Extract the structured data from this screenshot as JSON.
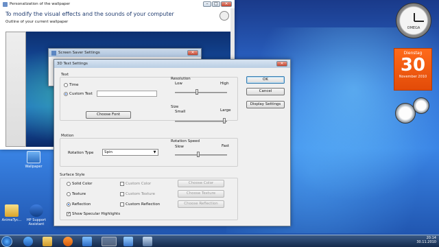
{
  "personalization": {
    "title": "Personalization of the wallpaper",
    "heading": "To modify the visual effects and the sounds of your computer",
    "subheading": "Outline of your current wallpaper"
  },
  "screensaver": {
    "title": "Screen Saver Settings"
  },
  "dialog3d": {
    "title": "3D Text Settings",
    "text_group": "Text",
    "time_label": "Time",
    "custom_text_label": "Custom Text",
    "custom_text_value": "",
    "choose_font": "Choose Font",
    "resolution_group": "Resolution",
    "resolution_low": "Low",
    "resolution_high": "High",
    "size_group": "Size",
    "size_small": "Small",
    "size_large": "Large",
    "motion_group": "Motion",
    "rotation_type_label": "Rotation Type",
    "rotation_type_value": "Spin",
    "rotation_speed_group": "Rotation Speed",
    "speed_slow": "Slow",
    "speed_fast": "Fast",
    "surface_group": "Surface Style",
    "solid_color": "Solid Color",
    "texture": "Texture",
    "reflection": "Reflection",
    "custom_color": "Custom Color",
    "custom_texture": "Custom Texture",
    "custom_reflection": "Custom Reflection",
    "choose_color": "Choose Color",
    "choose_texture": "Choose Texture",
    "choose_reflection": "Choose Reflection",
    "specular": "Show Specular Highlights",
    "ok": "OK",
    "cancel": "Cancel",
    "display_settings": "Display Settings"
  },
  "desktop": {
    "icons": [
      {
        "label": "Wallpaper"
      },
      {
        "label": "AnimeTyc..."
      },
      {
        "label": "HP Support Assistant"
      }
    ]
  },
  "gadgets": {
    "clock_brand": "OMEGA",
    "calendar_day": "Dienstag",
    "calendar_date": "30",
    "calendar_month": "November 2010"
  },
  "taskbar": {
    "time": "20:14",
    "date": "30.11.2010"
  },
  "colors": {
    "accent": "#2a6bd1",
    "calendar": "#ff6a1a"
  }
}
